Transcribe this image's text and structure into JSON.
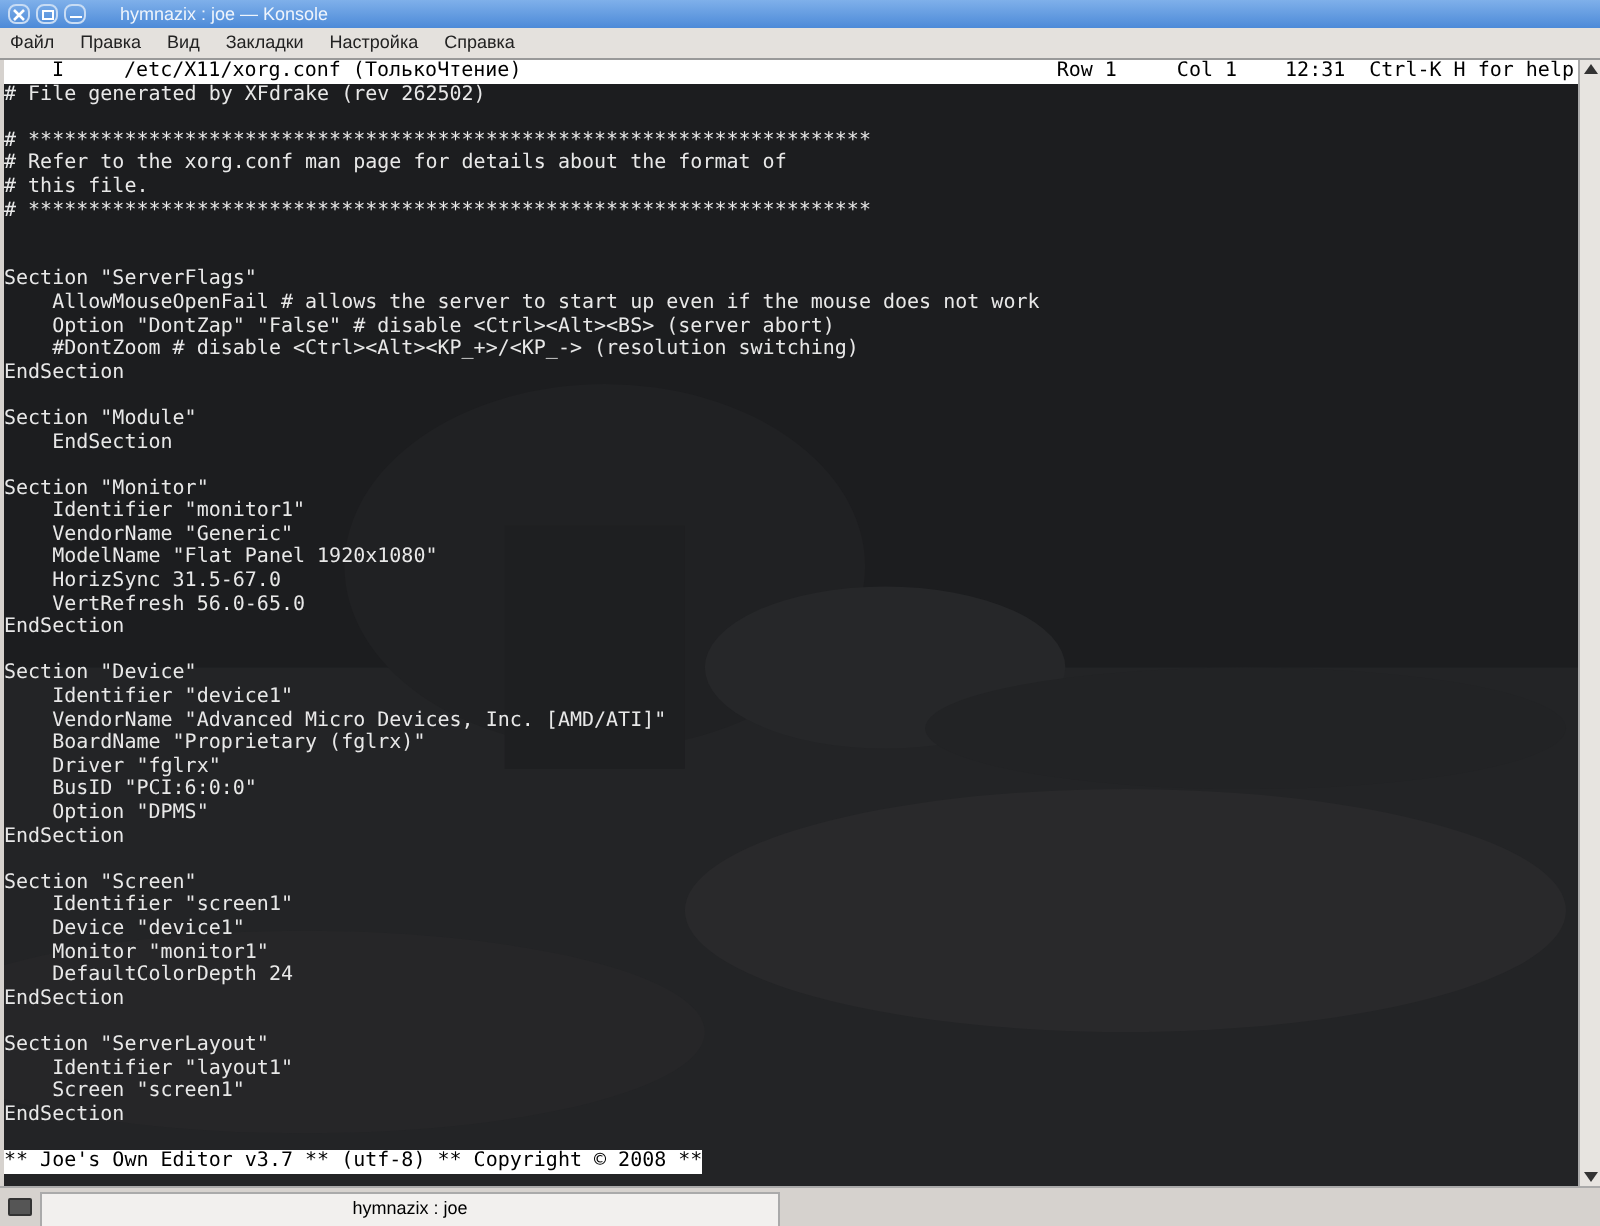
{
  "window": {
    "title": "hymnazix : joe — Konsole"
  },
  "menu": [
    "Файл",
    "Правка",
    "Вид",
    "Закладки",
    "Настройка",
    "Справка"
  ],
  "editor": {
    "header": {
      "mode": "I",
      "file": "/etc/X11/xorg.conf (ТолькоЧтение)",
      "row": "Row 1",
      "col": "Col 1",
      "time": "12:31",
      "help": "Ctrl-K H for help"
    },
    "lines": [
      {
        "kind": "text",
        "text": "# File generated by XFdrake (rev 262502)"
      },
      {
        "kind": "blank"
      },
      {
        "kind": "text",
        "text": "# **********************************************************************"
      },
      {
        "kind": "text",
        "text": "# Refer to the xorg.conf man page for details about the format of"
      },
      {
        "kind": "text",
        "text": "# this file."
      },
      {
        "kind": "text",
        "text": "# **********************************************************************"
      },
      {
        "kind": "blank"
      },
      {
        "kind": "blank"
      },
      {
        "kind": "text",
        "text": "Section \"ServerFlags\""
      },
      {
        "kind": "text",
        "text": "    AllowMouseOpenFail # allows the server to start up even if the mouse does not work"
      },
      {
        "kind": "text",
        "text": "    Option \"DontZap\" \"False\" # disable <Ctrl><Alt><BS> (server abort)"
      },
      {
        "kind": "text",
        "text": "    #DontZoom # disable <Ctrl><Alt><KP_+>/<KP_-> (resolution switching)"
      },
      {
        "kind": "text",
        "text": "EndSection"
      },
      {
        "kind": "blank"
      },
      {
        "kind": "text",
        "text": "Section \"Module\""
      },
      {
        "kind": "text",
        "text": "    EndSection"
      },
      {
        "kind": "blank"
      },
      {
        "kind": "text",
        "text": "Section \"Monitor\""
      },
      {
        "kind": "text",
        "text": "    Identifier \"monitor1\""
      },
      {
        "kind": "text",
        "text": "    VendorName \"Generic\""
      },
      {
        "kind": "text",
        "text": "    ModelName \"Flat Panel 1920x1080\""
      },
      {
        "kind": "text",
        "text": "    HorizSync 31.5-67.0"
      },
      {
        "kind": "text",
        "text": "    VertRefresh 56.0-65.0"
      },
      {
        "kind": "text",
        "text": "EndSection"
      },
      {
        "kind": "blank"
      },
      {
        "kind": "text",
        "text": "Section \"Device\""
      },
      {
        "kind": "text",
        "text": "    Identifier \"device1\""
      },
      {
        "kind": "text",
        "text": "    VendorName \"Advanced Micro Devices, Inc. [AMD/ATI]\""
      },
      {
        "kind": "text",
        "text": "    BoardName \"Proprietary (fglrx)\""
      },
      {
        "kind": "text",
        "text": "    Driver \"fglrx\""
      },
      {
        "kind": "text",
        "text": "    BusID \"PCI:6:0:0\""
      },
      {
        "kind": "text",
        "text": "    Option \"DPMS\""
      },
      {
        "kind": "text",
        "text": "EndSection"
      },
      {
        "kind": "blank"
      },
      {
        "kind": "text",
        "text": "Section \"Screen\""
      },
      {
        "kind": "text",
        "text": "    Identifier \"screen1\""
      },
      {
        "kind": "text",
        "text": "    Device \"device1\""
      },
      {
        "kind": "text",
        "text": "    Monitor \"monitor1\""
      },
      {
        "kind": "text",
        "text": "    DefaultColorDepth 24"
      },
      {
        "kind": "text",
        "text": "EndSection"
      },
      {
        "kind": "blank"
      },
      {
        "kind": "text",
        "text": "Section \"ServerLayout\""
      },
      {
        "kind": "text",
        "text": "    Identifier \"layout1\""
      },
      {
        "kind": "text",
        "text": "    Screen \"screen1\""
      },
      {
        "kind": "text",
        "text": "EndSection"
      },
      {
        "kind": "blank"
      }
    ],
    "status": "** Joe's Own Editor v3.7 ** (utf-8) ** Copyright © 2008 **"
  },
  "tabs": [
    {
      "label": "hymnazix : joe",
      "selected": true
    }
  ]
}
